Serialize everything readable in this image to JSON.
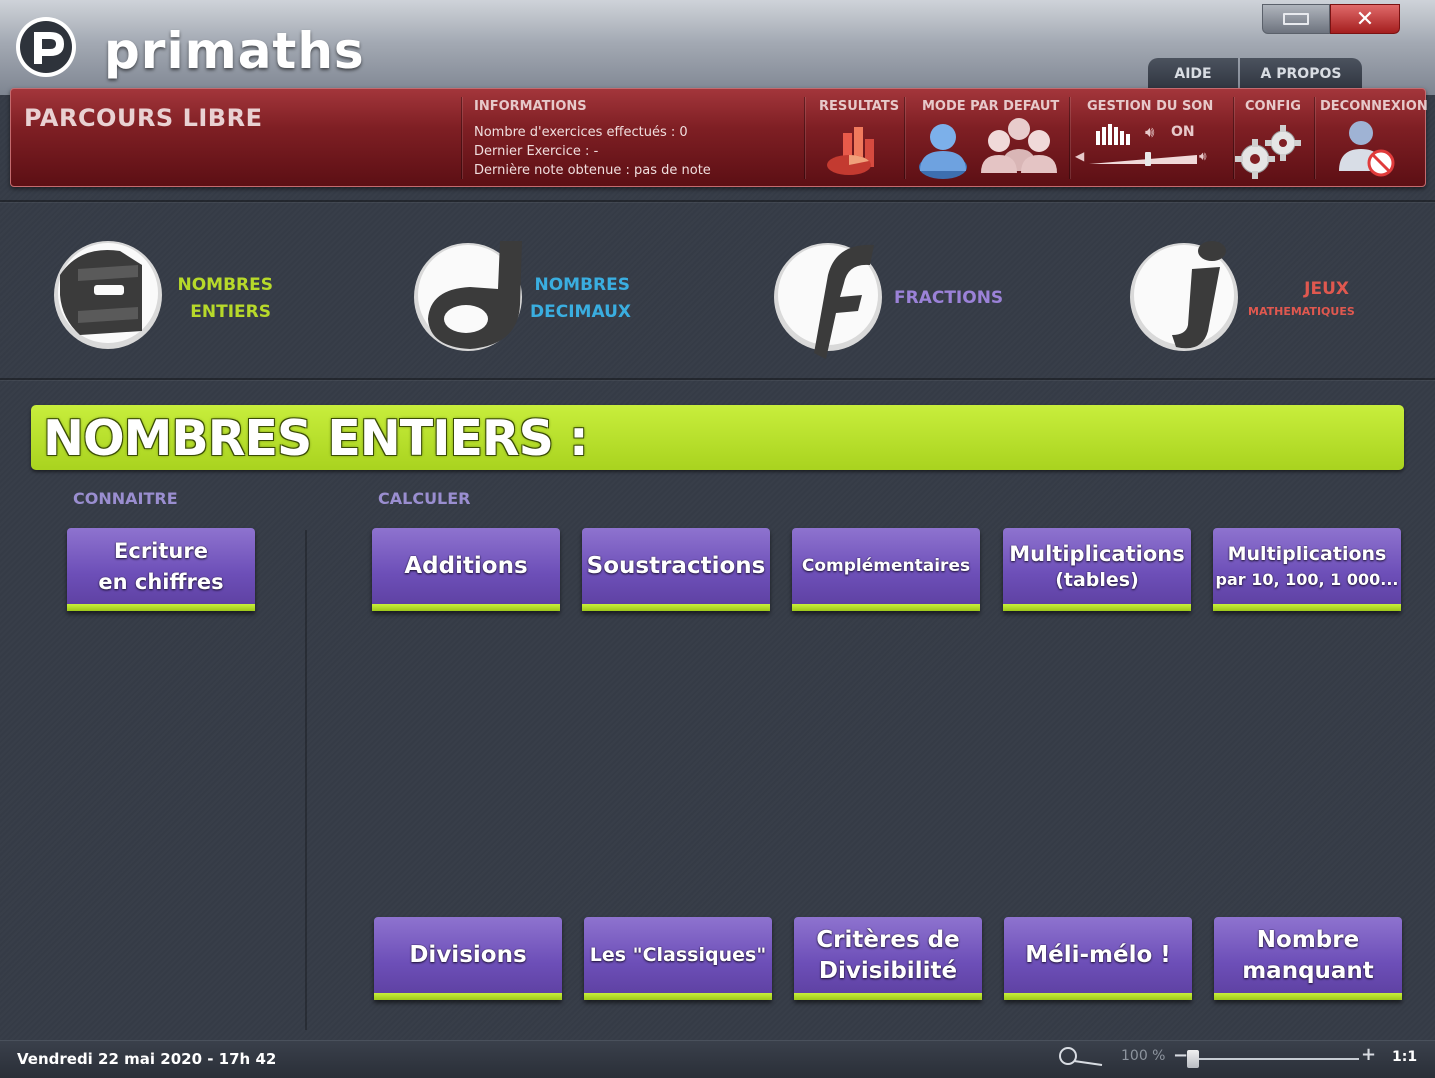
{
  "app": {
    "name": "primaths",
    "window_buttons": {
      "minimize": "minimize-icon",
      "close": "close-icon"
    },
    "top_tabs": [
      "AIDE",
      "A PROPOS"
    ]
  },
  "header": {
    "title": "PARCOURS LIBRE",
    "informations": {
      "label": "INFORMATIONS",
      "exercises_done": "Nombre d'exercices effectués : 0",
      "last_exercise": "Dernier Exercice : -",
      "last_grade": "Dernière note obtenue : pas de note"
    },
    "resultats": {
      "label": "RESULTATS",
      "icon": "chart-icon"
    },
    "mode": {
      "label": "MODE PAR DEFAUT",
      "icons": [
        "single-user-icon",
        "group-users-icon"
      ]
    },
    "sound": {
      "label": "GESTION DU SON",
      "state": "ON",
      "volume": 0.55
    },
    "config": {
      "label": "CONFIG",
      "icon": "gears-icon"
    },
    "logout": {
      "label": "DECONNEXION",
      "icon": "logout-user-icon"
    }
  },
  "categories": [
    {
      "id": "entiers",
      "line1": "NOMBRES",
      "line2": "ENTIERS",
      "color": "#b7d92a",
      "icon": "letter-e-icon"
    },
    {
      "id": "decimaux",
      "line1": "NOMBRES",
      "line2": "DECIMAUX",
      "color": "#3aaee0",
      "icon": "letter-d-icon"
    },
    {
      "id": "fractions",
      "line1": "FRACTIONS",
      "line2": "",
      "color": "#9b82d8",
      "icon": "letter-f-icon"
    },
    {
      "id": "jeux",
      "line1": "JEUX",
      "line2": "MATHEMATIQUES",
      "color": "#e0584f",
      "icon": "letter-j-icon"
    }
  ],
  "section": {
    "title": "NOMBRES ENTIERS :",
    "connaitre_label": "CONNAITRE",
    "calculer_label": "CALCULER"
  },
  "buttons": {
    "ecriture": {
      "line1": "Ecriture",
      "line2": "en chiffres"
    },
    "additions": {
      "line1": "Additions"
    },
    "soustractions": {
      "line1": "Soustractions"
    },
    "complementaires": {
      "line1": "Complémentaires"
    },
    "multiplications_tables": {
      "line1": "Multiplications",
      "line2": "(tables)"
    },
    "multiplications_par10": {
      "line1": "Multiplications",
      "line2": "par 10, 100, 1 000..."
    },
    "divisions": {
      "line1": "Divisions"
    },
    "classiques": {
      "line1": "Les \"Classiques\""
    },
    "divisibilite": {
      "line1": "Critères de",
      "line2": "Divisibilité"
    },
    "melimelo": {
      "line1": "Méli-mélo !"
    },
    "manquant": {
      "line1": "Nombre",
      "line2": "manquant"
    }
  },
  "status": {
    "date": "Vendredi 22 mai 2020 - 17h 42",
    "zoom_percent": "100 %",
    "zoom_level": 0.0,
    "zoom_ratio": "1:1"
  }
}
